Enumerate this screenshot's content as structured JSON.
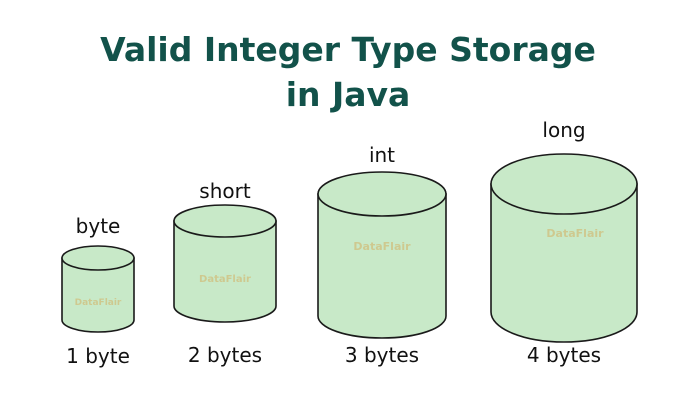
{
  "title": {
    "line1": "Valid Integer Type Storage",
    "line2": "in Java"
  },
  "cylinders": [
    {
      "type": "byte",
      "size": "1 byte",
      "bytes": 1
    },
    {
      "type": "short",
      "size": "2 bytes",
      "bytes": 2
    },
    {
      "type": "int",
      "size": "3 bytes",
      "bytes": 3
    },
    {
      "type": "long",
      "size": "4 bytes",
      "bytes": 4
    }
  ],
  "watermark": "DataFlair",
  "colors": {
    "title": "#12524a",
    "cylinder_fill": "#c8e9c8",
    "cylinder_stroke": "#1a1a1a"
  }
}
